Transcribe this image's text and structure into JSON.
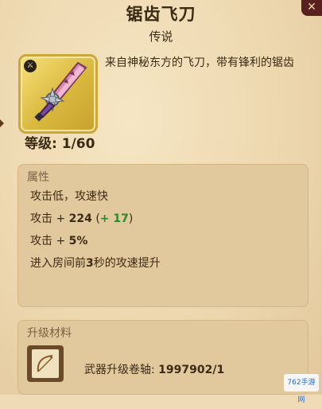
{
  "item": {
    "name": "锯齿飞刀",
    "rarity": "传说",
    "description": "来自神秘东方的飞刀，带有锋利的锯齿",
    "level": "等级: 1/60",
    "badge_icon": "crossed-swords-icon"
  },
  "attributes": {
    "title": "属性",
    "line1": "攻击低，攻速快",
    "line2_prefix": "攻击 + ",
    "line2_value": "224",
    "line2_bonus_open": " (",
    "line2_bonus": "+ 17",
    "line2_bonus_close": ")",
    "line3_prefix": "攻击 + ",
    "line3_value": "5%",
    "line4_a": "进入房间前",
    "line4_b": "3",
    "line4_c": "秒的攻速提升"
  },
  "materials": {
    "title": "升级材料",
    "name": "武器升级卷轴: ",
    "count": "1997902/1"
  },
  "watermark": {
    "text": "762手游网"
  },
  "colors": {
    "bonus_green": "#2b8a2b",
    "frame_gold": "#d9b83e",
    "close_red": "#5a1f1f"
  }
}
